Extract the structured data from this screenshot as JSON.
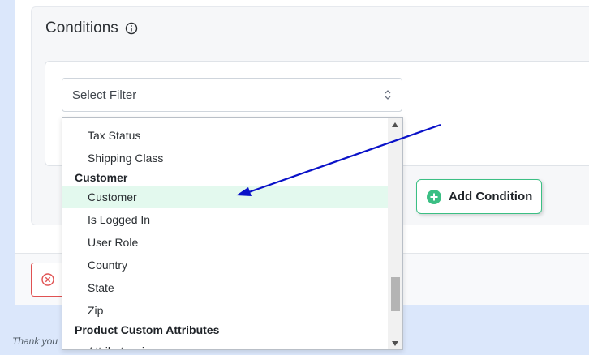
{
  "conditions": {
    "title": "Conditions",
    "info_icon": "info-circle-icon"
  },
  "filter": {
    "placeholder": "Select Filter",
    "arrow_icon": "select-arrows-icon"
  },
  "dropdown": {
    "items": [
      {
        "type": "option",
        "label": "Tax Status"
      },
      {
        "type": "option",
        "label": "Shipping Class"
      },
      {
        "type": "group",
        "label": "Customer"
      },
      {
        "type": "option",
        "label": "Customer",
        "selected": true
      },
      {
        "type": "option",
        "label": "Is Logged In"
      },
      {
        "type": "option",
        "label": "User Role"
      },
      {
        "type": "option",
        "label": "Country"
      },
      {
        "type": "option",
        "label": "State"
      },
      {
        "type": "option",
        "label": "Zip"
      },
      {
        "type": "group",
        "label": "Product Custom Attributes"
      },
      {
        "type": "option",
        "label": "Attribute_size"
      }
    ],
    "scroll_position": 0.85
  },
  "actions": {
    "add_condition": "Add Condition",
    "add_icon": "plus-circle-icon",
    "reset_icon": "close-circle-icon"
  },
  "footer": {
    "thanks": "Thank you"
  },
  "colors": {
    "accent_green": "#3bbf84",
    "selected_bg": "#e3f9ee",
    "danger_red": "#e05252",
    "annotation_blue": "#0a12c8",
    "page_bg": "#dbe7fb"
  }
}
